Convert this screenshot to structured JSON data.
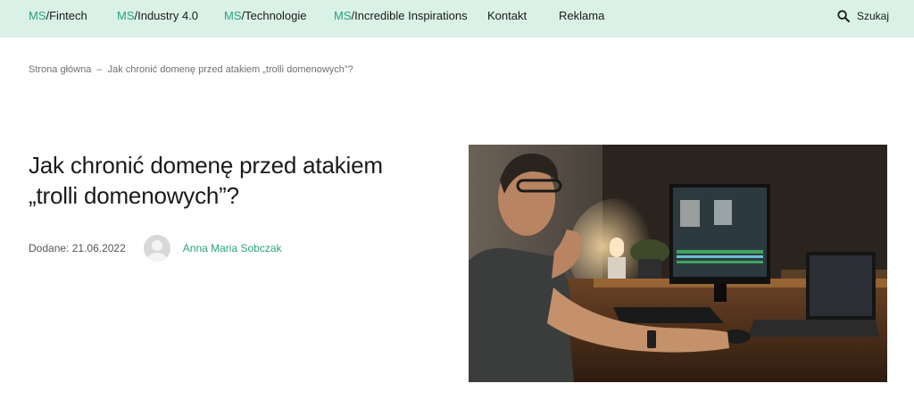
{
  "nav": {
    "items": [
      {
        "prefix": "MS",
        "label": "/Fintech"
      },
      {
        "prefix": "MS",
        "label": "/Industry 4.0"
      },
      {
        "prefix": "MS",
        "label": "/Technologie"
      },
      {
        "prefix": "MS",
        "label": "/Incredible Inspirations"
      },
      {
        "prefix": "",
        "label": "Kontakt"
      },
      {
        "prefix": "",
        "label": "Reklama"
      }
    ],
    "search_label": "Szukaj",
    "search_icon": "search-icon"
  },
  "breadcrumb": {
    "home": "Strona główna",
    "separator": "–",
    "current": "Jak chronić domenę przed atakiem „trolli domenowych”?"
  },
  "article": {
    "title_line1": "Jak chronić domenę przed atakiem",
    "title_line2": "„trolli domenowych”?",
    "date_label": "Dodane:",
    "date_value": "21.06.2022",
    "author": "Anna Maria Sobczak"
  },
  "colors": {
    "nav_bg": "#d9f1e6",
    "accent": "#2aa37d",
    "text": "#1a1a1a",
    "muted": "#6f6f6f"
  }
}
